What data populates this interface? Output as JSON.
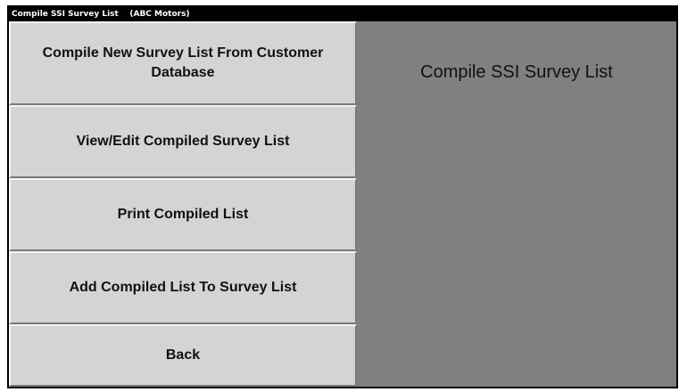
{
  "window": {
    "title": "Compile SSI Survey List    (ABC Motors)"
  },
  "menu": {
    "items": [
      {
        "label": "Compile New Survey List From Customer Database"
      },
      {
        "label": "View/Edit Compiled Survey List"
      },
      {
        "label": "Print Compiled List"
      },
      {
        "label": "Add Compiled List To Survey List"
      },
      {
        "label": "Back"
      }
    ]
  },
  "panel": {
    "heading": "Compile SSI Survey List"
  },
  "colors": {
    "titlebar": "#000000",
    "button_face": "#d4d4d4",
    "panel_background": "#808080"
  }
}
